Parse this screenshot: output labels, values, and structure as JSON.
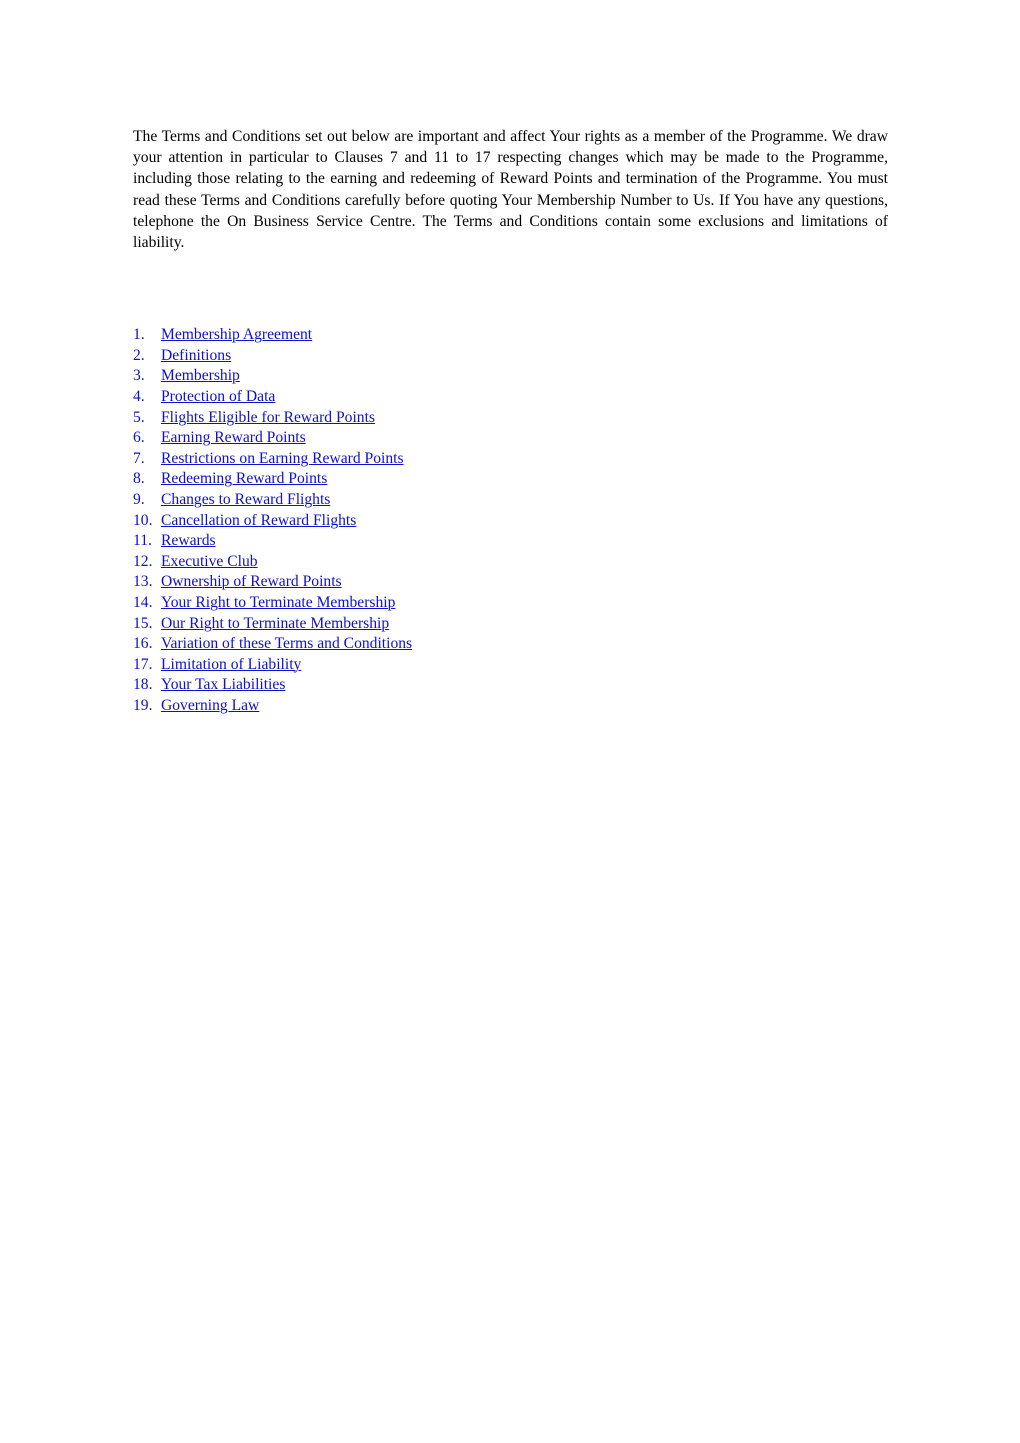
{
  "document": {
    "intro_paragraph": "The Terms and Conditions set out below are important and affect Your rights as a member of the Programme. We draw your attention in particular to Clauses 7 and 11 to 17 respecting changes which may be made to the Programme, including those relating to the earning and redeeming of Reward Points and termination of the Programme. You must read these Terms and Conditions carefully before quoting Your Membership Number to Us. If You have any questions, telephone the On Business Service Centre. The Terms and Conditions contain some exclusions and limitations of liability.",
    "link_color": "#1010C8",
    "text_color": "#000000",
    "background_color": "#FFFFFF"
  },
  "toc": {
    "items": [
      {
        "number": "1.",
        "label": "Membership Agreement"
      },
      {
        "number": "2.",
        "label": "Definitions"
      },
      {
        "number": "3.",
        "label": "Membership"
      },
      {
        "number": "4.",
        "label": "Protection of Data"
      },
      {
        "number": "5.",
        "label": "Flights Eligible for Reward Points"
      },
      {
        "number": "6.",
        "label": "Earning Reward Points"
      },
      {
        "number": "7.",
        "label": "Restrictions on Earning Reward Points"
      },
      {
        "number": "8.",
        "label": "Redeeming Reward Points"
      },
      {
        "number": "9.",
        "label": "Changes to Reward Flights"
      },
      {
        "number": "10.",
        "label": "Cancellation of Reward Flights"
      },
      {
        "number": "11.",
        "label": "Rewards"
      },
      {
        "number": "12.",
        "label": "Executive Club"
      },
      {
        "number": "13.",
        "label": "Ownership of Reward Points"
      },
      {
        "number": "14.",
        "label": "Your Right to Terminate Membership"
      },
      {
        "number": "15.",
        "label": "Our Right to Terminate Membership"
      },
      {
        "number": "16.",
        "label": "Variation of these Terms and Conditions"
      },
      {
        "number": "17.",
        "label": "Limitation of Liability"
      },
      {
        "number": "18.",
        "label": "Your Tax Liabilities"
      },
      {
        "number": "19.",
        "label": "Governing Law"
      }
    ]
  }
}
